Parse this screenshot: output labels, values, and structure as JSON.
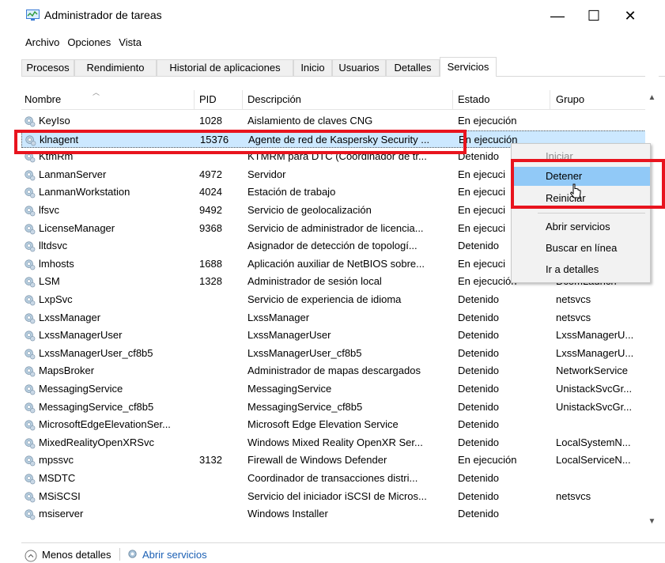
{
  "window": {
    "title": "Administrador de tareas",
    "controls": {
      "minimize": "—",
      "maximize": "☐",
      "close": "✕"
    }
  },
  "menubar": [
    "Archivo",
    "Opciones",
    "Vista"
  ],
  "tabs": [
    "Procesos",
    "Rendimiento",
    "Historial de aplicaciones",
    "Inicio",
    "Usuarios",
    "Detalles",
    "Servicios"
  ],
  "active_tab": "Servicios",
  "columns": [
    "Nombre",
    "PID",
    "Descripción",
    "Estado",
    "Grupo"
  ],
  "rows": [
    {
      "name": "KeyIso",
      "pid": "1028",
      "desc": "Aislamiento de claves CNG",
      "state": "En ejecución",
      "group": ""
    },
    {
      "name": "klnagent",
      "pid": "15376",
      "desc": "Agente de red de Kaspersky Security ...",
      "state": "En ejecución",
      "group": ""
    },
    {
      "name": "KtmRm",
      "pid": "",
      "desc": "KTMRM para DTC (Coordinador de tr...",
      "state": "Detenido",
      "group": ""
    },
    {
      "name": "LanmanServer",
      "pid": "4972",
      "desc": "Servidor",
      "state": "En ejecuci",
      "group": ""
    },
    {
      "name": "LanmanWorkstation",
      "pid": "4024",
      "desc": "Estación de trabajo",
      "state": "En ejecuci",
      "group": ""
    },
    {
      "name": "lfsvc",
      "pid": "9492",
      "desc": "Servicio de geolocalización",
      "state": "En ejecuci",
      "group": ""
    },
    {
      "name": "LicenseManager",
      "pid": "9368",
      "desc": "Servicio de administrador de licencia...",
      "state": "En ejecuci",
      "group": ""
    },
    {
      "name": "lltdsvc",
      "pid": "",
      "desc": "Asignador de detección de topologí...",
      "state": "Detenido",
      "group": ""
    },
    {
      "name": "lmhosts",
      "pid": "1688",
      "desc": "Aplicación auxiliar de NetBIOS sobre...",
      "state": "En ejecuci",
      "group": ""
    },
    {
      "name": "LSM",
      "pid": "1328",
      "desc": "Administrador de sesión local",
      "state": "En ejecución",
      "group": "DcomLaunch"
    },
    {
      "name": "LxpSvc",
      "pid": "",
      "desc": "Servicio de experiencia de idioma",
      "state": "Detenido",
      "group": "netsvcs"
    },
    {
      "name": "LxssManager",
      "pid": "",
      "desc": "LxssManager",
      "state": "Detenido",
      "group": "netsvcs"
    },
    {
      "name": "LxssManagerUser",
      "pid": "",
      "desc": "LxssManagerUser",
      "state": "Detenido",
      "group": "LxssManagerU..."
    },
    {
      "name": "LxssManagerUser_cf8b5",
      "pid": "",
      "desc": "LxssManagerUser_cf8b5",
      "state": "Detenido",
      "group": "LxssManagerU..."
    },
    {
      "name": "MapsBroker",
      "pid": "",
      "desc": "Administrador de mapas descargados",
      "state": "Detenido",
      "group": "NetworkService"
    },
    {
      "name": "MessagingService",
      "pid": "",
      "desc": "MessagingService",
      "state": "Detenido",
      "group": "UnistackSvcGr..."
    },
    {
      "name": "MessagingService_cf8b5",
      "pid": "",
      "desc": "MessagingService_cf8b5",
      "state": "Detenido",
      "group": "UnistackSvcGr..."
    },
    {
      "name": "MicrosoftEdgeElevationSer...",
      "pid": "",
      "desc": "Microsoft Edge Elevation Service",
      "state": "Detenido",
      "group": ""
    },
    {
      "name": "MixedRealityOpenXRSvc",
      "pid": "",
      "desc": "Windows Mixed Reality OpenXR Ser...",
      "state": "Detenido",
      "group": "LocalSystemN..."
    },
    {
      "name": "mpssvc",
      "pid": "3132",
      "desc": "Firewall de Windows Defender",
      "state": "En ejecución",
      "group": "LocalServiceN..."
    },
    {
      "name": "MSDTC",
      "pid": "",
      "desc": "Coordinador de transacciones distri...",
      "state": "Detenido",
      "group": ""
    },
    {
      "name": "MSiSCSI",
      "pid": "",
      "desc": "Servicio del iniciador iSCSI de Micros...",
      "state": "Detenido",
      "group": "netsvcs"
    },
    {
      "name": "msiserver",
      "pid": "",
      "desc": "Windows Installer",
      "state": "Detenido",
      "group": ""
    }
  ],
  "selected_row": "klnagent",
  "context_menu": {
    "iniciar": "Iniciar",
    "detener": "Detener",
    "reiniciar": "Reiniciar",
    "abrir_servicios": "Abrir servicios",
    "buscar": "Buscar en línea",
    "ir_detalles": "Ir a detalles"
  },
  "footer": {
    "less_details": "Menos detalles",
    "open_services": "Abrir servicios"
  },
  "colors": {
    "highlight_box": "#e8141e",
    "selection": "#cce8ff",
    "menu_hover": "#91c9f7",
    "link": "#1a5fb4"
  }
}
